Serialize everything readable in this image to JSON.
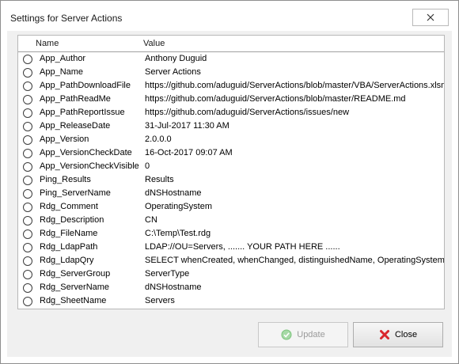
{
  "window": {
    "title": "Settings for Server Actions"
  },
  "list": {
    "columns": {
      "name": "Name",
      "value": "Value"
    },
    "rows": [
      {
        "name": "App_Author",
        "value": "Anthony Duguid"
      },
      {
        "name": "App_Name",
        "value": "Server Actions"
      },
      {
        "name": "App_PathDownloadFile",
        "value": "https://github.com/aduguid/ServerActions/blob/master/VBA/ServerActions.xlsm"
      },
      {
        "name": "App_PathReadMe",
        "value": "https://github.com/aduguid/ServerActions/blob/master/README.md"
      },
      {
        "name": "App_PathReportIssue",
        "value": "https://github.com/aduguid/ServerActions/issues/new"
      },
      {
        "name": "App_ReleaseDate",
        "value": "31-Jul-2017 11:30 AM"
      },
      {
        "name": "App_Version",
        "value": "2.0.0.0"
      },
      {
        "name": "App_VersionCheckDate",
        "value": "16-Oct-2017 09:07 AM"
      },
      {
        "name": "App_VersionCheckVisible",
        "value": "0"
      },
      {
        "name": "Ping_Results",
        "value": "Results"
      },
      {
        "name": "Ping_ServerName",
        "value": "dNSHostname"
      },
      {
        "name": "Rdg_Comment",
        "value": "OperatingSystem"
      },
      {
        "name": "Rdg_Description",
        "value": "CN"
      },
      {
        "name": "Rdg_FileName",
        "value": "C:\\Temp\\Test.rdg"
      },
      {
        "name": "Rdg_LdapPath",
        "value": "LDAP://OU=Servers, ....... YOUR PATH HERE ......"
      },
      {
        "name": "Rdg_LdapQry",
        "value": "SELECT whenCreated, whenChanged, distinguishedName, OperatingSystem, CN"
      },
      {
        "name": "Rdg_ServerGroup",
        "value": "ServerType"
      },
      {
        "name": "Rdg_ServerName",
        "value": "dNSHostname"
      },
      {
        "name": "Rdg_SheetName",
        "value": "Servers"
      }
    ]
  },
  "buttons": {
    "update_label": "Update",
    "close_label": "Close"
  },
  "icons": {
    "update": "check-circle-icon",
    "close": "red-x-icon",
    "window_close": "close-icon"
  },
  "colors": {
    "client_bg": "#f0f0f0",
    "close_red": "#d9262c",
    "update_green": "#7cc47c"
  }
}
